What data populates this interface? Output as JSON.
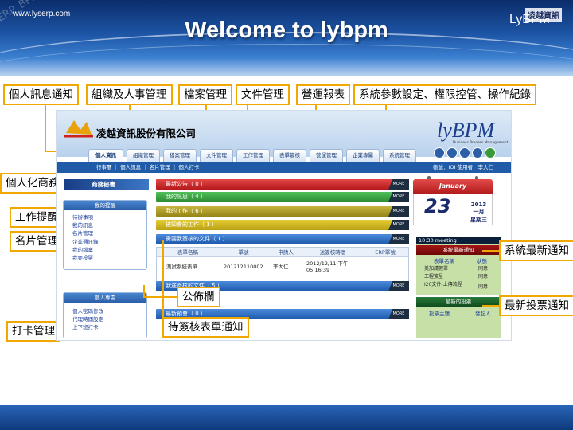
{
  "header": {
    "title": "Welcome to lybpm",
    "brand": "LyBPM",
    "watermark": "ERP_BPM_BI_Flow"
  },
  "callouts": {
    "personal_notice": "個人訊息通知",
    "org_hr": "組織及人事管理",
    "file_mgmt": "檔案管理",
    "doc_mgmt": "文件管理",
    "ops_report": "營運報表",
    "sys_params": "系統參數設定、權限控管、操作紀錄",
    "secretary": "個人化商務秘書",
    "work_reminder": "工作提醒",
    "card_mgmt": "名片管理",
    "clock_mgmt": "打卡管理",
    "bulletin": "公佈欄",
    "pending_approval": "待簽核表單通知",
    "latest_notice": "系統最新通知",
    "latest_vote": "最新投票通知"
  },
  "erp": {
    "company": "凌越資訊股份有限公司",
    "logo_text": "lyBPM",
    "logo_sub": "Business Process Management",
    "tabs": [
      "個人資訊",
      "組織管理",
      "檔案管理",
      "文件管理",
      "工作管理",
      "表單簽核",
      "營運管理",
      "企業專屬",
      "系統管理"
    ],
    "subnav": "行事曆 ｜ 個人訊息 ｜ 名片管理 ｜ 個人打卡",
    "userinfo": "帳號：IOI  使用者：李大仁",
    "sidebar": {
      "main": "商務秘書",
      "reminder_title": "我的提醒",
      "reminder_items": [
        "待辦事項",
        "我的訊息",
        "名片管理",
        "企業通訊錄",
        "我的檔案",
        "我要投票"
      ],
      "personal_title": "個人專區",
      "personal_items": [
        "個人密碼修改",
        "代理時間設定",
        "上下班打卡"
      ]
    },
    "bars": {
      "announce": "最新公告（ 0 ）",
      "messages": "我的訊息（ 4 ）",
      "work": "我的工作（ 6 ）",
      "notify_work": "被知會的工作（ 1 ）",
      "pending": "需要我簽核的文件（ 1 ）",
      "sent": "我送簽核的文件（ 5 ）",
      "meeting": "最新預會（ 0 ）",
      "more": "MORE"
    },
    "pending_table": {
      "headers": [
        "表單名稱",
        "單號",
        "申請人",
        "送簽核時間",
        "ERP單號"
      ],
      "row": [
        "測試系統表單",
        "201212110002",
        "李大仁",
        "2012/12/11 下午 05:16:39",
        ""
      ]
    },
    "calendar": {
      "month": "January",
      "day": "23",
      "year": "2013",
      "month_zh": "一月",
      "weekday": "星期三"
    },
    "meeting": "10:30  meeting",
    "sys_notice": {
      "title": "系統最新通知",
      "headers": [
        "表單名稱",
        "狀態"
      ],
      "rows": [
        [
          "美加請假單",
          "同意"
        ],
        [
          "工程簽呈",
          "同意"
        ],
        [
          "I20文件-上傳流程",
          "同意"
        ]
      ]
    },
    "vote": {
      "title": "最新的投票",
      "headers": [
        "投票主題",
        "發起人"
      ]
    }
  },
  "footer": {
    "url": "www.lyserp.com",
    "brand": "凌越資訊"
  }
}
